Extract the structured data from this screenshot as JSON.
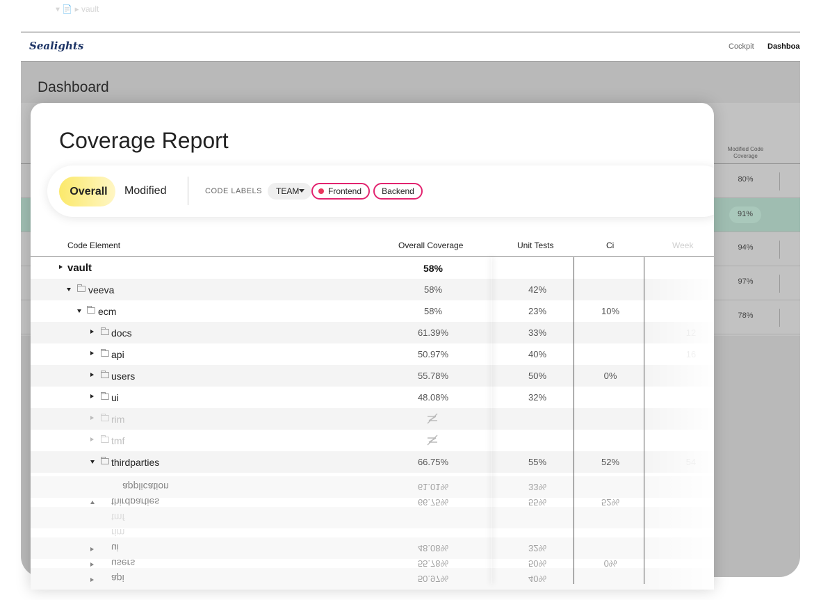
{
  "app": {
    "ghost_text": "▾ 📄  ▸ vault",
    "logo": "Sealights",
    "nav": [
      "Cockpit",
      "Dashboard"
    ],
    "page_title": "Dashboard"
  },
  "background_table": {
    "column_title": "Modified Code Coverage",
    "values": [
      "80%",
      "91%",
      "94%",
      "97%",
      "78%"
    ]
  },
  "report": {
    "title": "Coverage Report",
    "segments": [
      "Overall",
      "Modified"
    ],
    "code_labels_title": "CODE LABELS",
    "team_dropdown": "TEAM",
    "chips": [
      "Frontend",
      "Backend"
    ],
    "columns": [
      "Code Element",
      "Overall Coverage",
      "Unit Tests",
      "Ci",
      "Week"
    ],
    "rows": [
      {
        "name": "vault",
        "overall": "58%",
        "unit": "",
        "ci": "",
        "week": ""
      },
      {
        "name": "veeva",
        "overall": "58%",
        "unit": "42%",
        "ci": "",
        "week": ""
      },
      {
        "name": "ecm",
        "overall": "58%",
        "unit": "23%",
        "ci": "10%",
        "week": ""
      },
      {
        "name": "docs",
        "overall": "61.39%",
        "unit": "33%",
        "ci": "",
        "week": "12"
      },
      {
        "name": "api",
        "overall": "50.97%",
        "unit": "40%",
        "ci": "",
        "week": "16"
      },
      {
        "name": "users",
        "overall": "55.78%",
        "unit": "50%",
        "ci": "0%",
        "week": ""
      },
      {
        "name": "ui",
        "overall": "48.08%",
        "unit": "32%",
        "ci": "",
        "week": ""
      },
      {
        "name": "rim",
        "overall": "",
        "unit": "",
        "ci": "",
        "week": ""
      },
      {
        "name": "tmf",
        "overall": "",
        "unit": "",
        "ci": "",
        "week": ""
      },
      {
        "name": "thirdparties",
        "overall": "66.75%",
        "unit": "55%",
        "ci": "52%",
        "week": "54"
      }
    ],
    "reflection_row": {
      "name": "application",
      "overall": "61.01%",
      "unit": "33%"
    },
    "icons": {
      "no_coverage": "no-coverage-icon",
      "folder": "folder-icon"
    }
  }
}
